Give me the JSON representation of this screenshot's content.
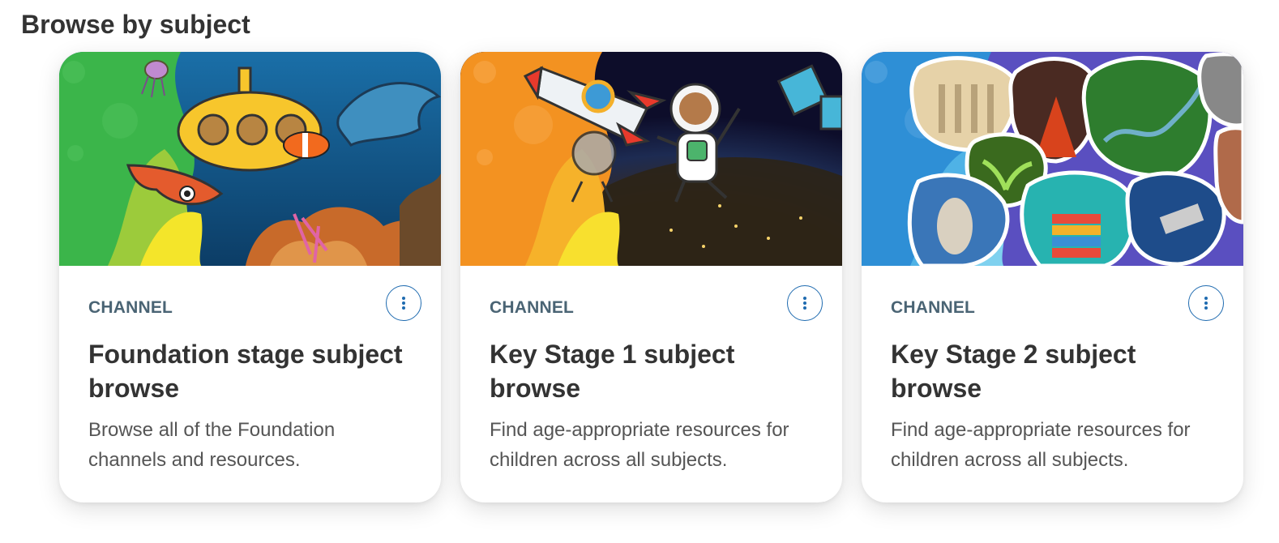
{
  "section": {
    "title": "Browse by subject"
  },
  "cards": [
    {
      "eyebrow": "CHANNEL",
      "title": "Foundation stage subject browse",
      "description": "Browse all of the Foundation channels and resources.",
      "theme_color": "#3bb54a"
    },
    {
      "eyebrow": "CHANNEL",
      "title": "Key Stage 1 subject browse",
      "description": "Find age-appropriate resources for children across all subjects.",
      "theme_color": "#f39221"
    },
    {
      "eyebrow": "CHANNEL",
      "title": "Key Stage 2 subject browse",
      "description": "Find age-appropriate resources for children across all subjects.",
      "theme_color": "#2e8fd6"
    }
  ],
  "colors": {
    "accent": "#1f6bb0",
    "eyebrow": "#4a6474"
  }
}
